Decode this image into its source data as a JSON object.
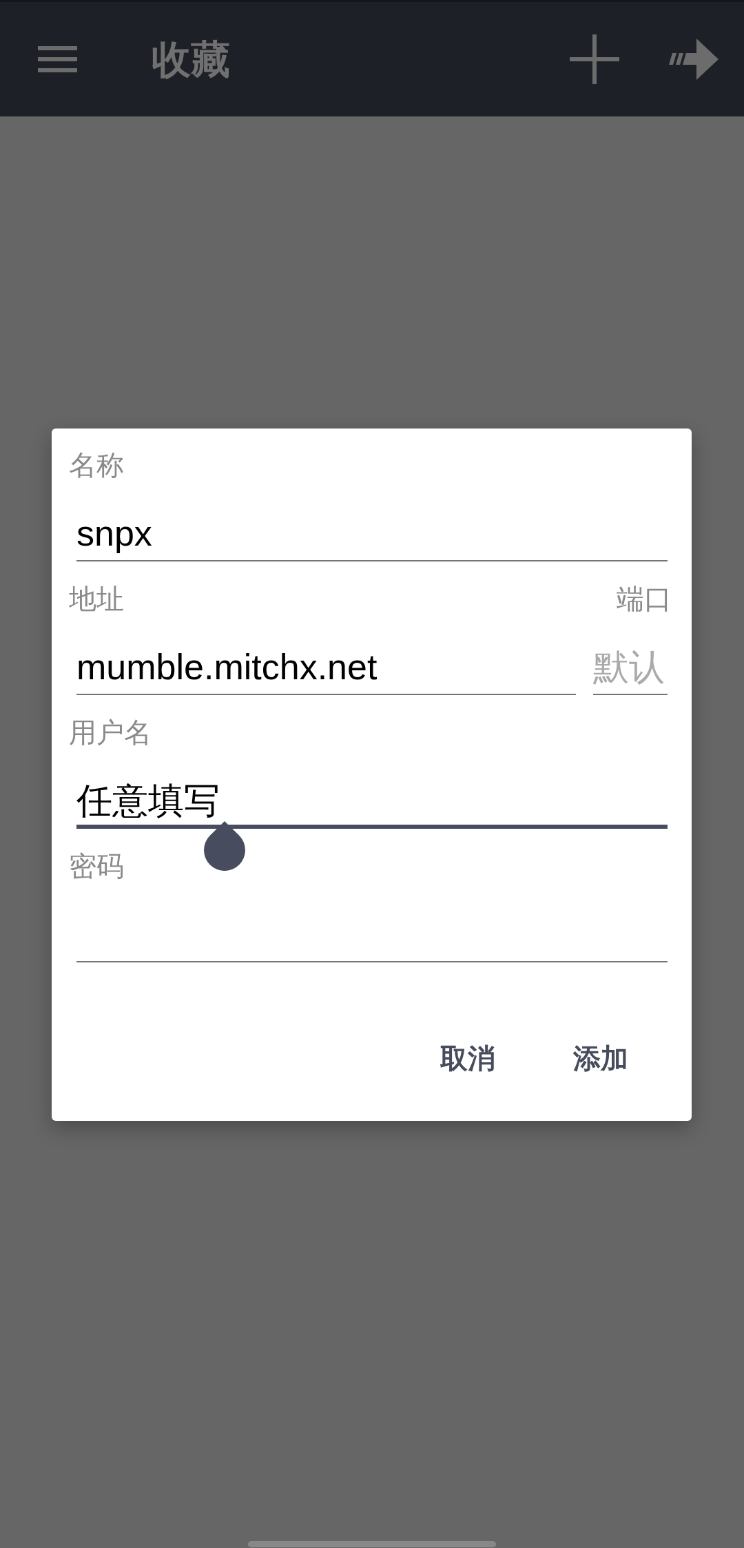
{
  "toolbar": {
    "title": "收藏"
  },
  "dialog": {
    "fields": [
      {
        "kind": "text",
        "label": "名称",
        "value": "snpx",
        "focused": false
      },
      {
        "kind": "address",
        "label": "地址",
        "value": "mumble.mitchx.net",
        "focused": false,
        "port_label": "端口",
        "port_placeholder": "默认"
      },
      {
        "kind": "text",
        "label": "用户名",
        "value": "任意填写",
        "focused": true
      },
      {
        "kind": "text",
        "label": "密码",
        "focused": false
      }
    ],
    "buttons": [
      "取消",
      "添加"
    ]
  }
}
